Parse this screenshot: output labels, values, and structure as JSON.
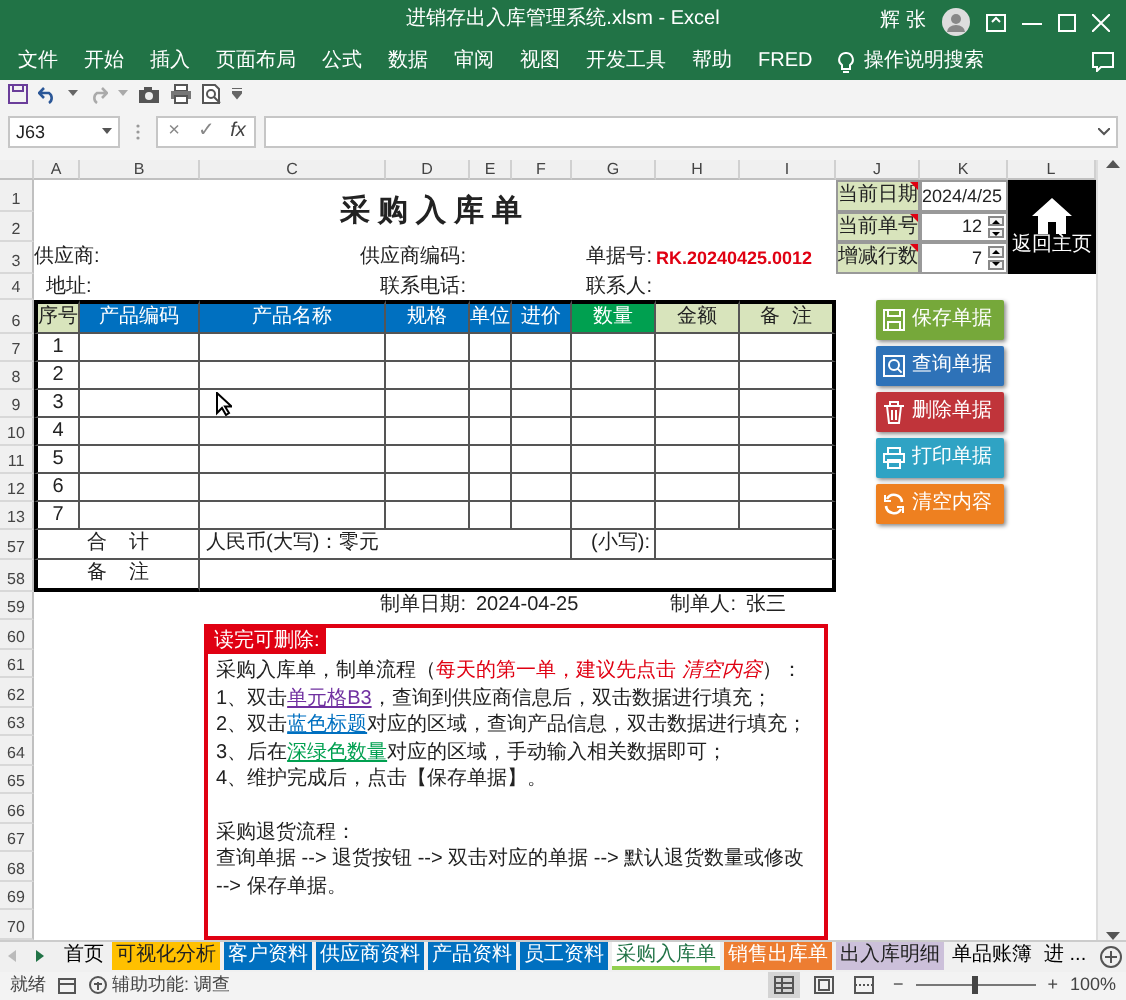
{
  "window": {
    "title": "进销存出入库管理系统.xlsm  -  Excel",
    "user": "辉 张"
  },
  "ribbon_tabs": [
    "文件",
    "开始",
    "插入",
    "页面布局",
    "公式",
    "数据",
    "审阅",
    "视图",
    "开发工具",
    "帮助",
    "FRED"
  ],
  "tell_me": "操作说明搜索",
  "formula_bar": {
    "name_box": "J63",
    "cancel": "×",
    "enter": "✓",
    "function": "fx"
  },
  "columns": [
    "A",
    "B",
    "C",
    "D",
    "E",
    "F",
    "G",
    "H",
    "I",
    "J",
    "K",
    "L"
  ],
  "rows": [
    "1",
    "2",
    "3",
    "4",
    "6",
    "7",
    "8",
    "9",
    "10",
    "11",
    "12",
    "13",
    "57",
    "58",
    "59",
    "60",
    "61",
    "62",
    "63",
    "64",
    "65",
    "66",
    "67",
    "68",
    "69",
    "70"
  ],
  "form": {
    "title": "采购入库单",
    "info": [
      {
        "label": "当前日期",
        "value": "2024/4/25",
        "kind": "date"
      },
      {
        "label": "当前单号",
        "value": "12",
        "kind": "spinner"
      },
      {
        "label": "增减行数",
        "value": "7",
        "kind": "spinner"
      }
    ],
    "home_button": "返回主页",
    "supplier_label": "供应商:",
    "supplier_code_label": "供应商编码:",
    "doc_no_label": "单据号:",
    "doc_no": "RK.20240425.0012",
    "address_label": "地址:",
    "phone_label": "联系电话:",
    "contact_label": "联系人:",
    "columns": [
      {
        "label": "序号",
        "color": "#d8e4bc"
      },
      {
        "label": "产品编码",
        "color": "#0070c0"
      },
      {
        "label": "产品名称",
        "color": "#0070c0"
      },
      {
        "label": "规格",
        "color": "#0070c0"
      },
      {
        "label": "单位",
        "color": "#0070c0"
      },
      {
        "label": "进价",
        "color": "#0070c0"
      },
      {
        "label": "数量",
        "color": "#00a050"
      },
      {
        "label": "金额",
        "color": "#d8e4bc"
      },
      {
        "label": "备  注",
        "color": "#d8e4bc"
      }
    ],
    "line_numbers": [
      "1",
      "2",
      "3",
      "4",
      "5",
      "6",
      "7"
    ],
    "total_label": "合    计",
    "amount_words": "人民币(大写)：零元",
    "amount_figures_label": "(小写):",
    "remark_label": "备    注",
    "prepared_date_label": "制单日期:",
    "prepared_date": "2024-04-25",
    "preparer_label": "制单人:",
    "preparer": "张三"
  },
  "actions": [
    {
      "label": "保存单据",
      "kind": "save",
      "color": "#76a83a"
    },
    {
      "label": "查询单据",
      "kind": "search",
      "color": "#2e72b8"
    },
    {
      "label": "删除单据",
      "kind": "delete",
      "color": "#c0343a"
    },
    {
      "label": "打印单据",
      "kind": "print",
      "color": "#2fa3c4"
    },
    {
      "label": "清空内容",
      "kind": "clear",
      "color": "#ee8020"
    }
  ],
  "notice": {
    "badge": "读完可删除:",
    "lines": [
      {
        "gap_before": false,
        "segments": [
          {
            "text": "采购入库单，制单流程（",
            "kind": "plain"
          },
          {
            "text": "每天的第一单，建议先点击 *清空内容*",
            "kind": "red"
          },
          {
            "text": "）：",
            "kind": "plain"
          }
        ]
      },
      {
        "gap_before": false,
        "segments": [
          {
            "text": "1、双击",
            "kind": "plain"
          },
          {
            "text": "单元格B3",
            "kind": "link_purple"
          },
          {
            "text": "，查询到供应商信息后，双击数据进行填充；",
            "kind": "plain"
          }
        ]
      },
      {
        "gap_before": false,
        "segments": [
          {
            "text": "2、双击",
            "kind": "plain"
          },
          {
            "text": "蓝色标题",
            "kind": "link_blue"
          },
          {
            "text": "对应的区域，查询产品信息，双击数据进行填充；",
            "kind": "plain"
          }
        ]
      },
      {
        "gap_before": false,
        "segments": [
          {
            "text": "3、后在",
            "kind": "plain"
          },
          {
            "text": "深绿色数量",
            "kind": "link_green"
          },
          {
            "text": "对应的区域，手动输入相关数据即可；",
            "kind": "plain"
          }
        ]
      },
      {
        "gap_before": false,
        "segments": [
          {
            "text": "4、维护完成后，点击【保存单据】。",
            "kind": "plain"
          }
        ]
      },
      {
        "gap_before": true,
        "segments": [
          {
            "text": "采购退货流程：",
            "kind": "plain"
          }
        ]
      },
      {
        "gap_before": false,
        "segments": [
          {
            "text": "查询单据 --> 退货按钮 --> 双击对应的单据 --> 默认退货数量或修改 --> 保存单据。",
            "kind": "plain"
          }
        ]
      }
    ]
  },
  "sheet_tabs": [
    {
      "label": "首页",
      "selected": false
    },
    {
      "label": "可视化分析",
      "selected": false,
      "color": "#ffc000"
    },
    {
      "label": "客户资料",
      "selected": false,
      "color": "#0070c0"
    },
    {
      "label": "供应商资料",
      "selected": false,
      "color": "#0070c0"
    },
    {
      "label": "产品资料",
      "selected": false,
      "color": "#0070c0"
    },
    {
      "label": "员工资料",
      "selected": false,
      "color": "#0070c0"
    },
    {
      "label": "采购入库单",
      "selected": true,
      "color": "#92d050"
    },
    {
      "label": "销售出库单",
      "selected": false,
      "color": "#ed7d31"
    },
    {
      "label": "出入库明细",
      "selected": false,
      "color": "#ccc0da"
    },
    {
      "label": "单品账簿",
      "selected": false
    },
    {
      "label": "进 ...",
      "selected": false
    }
  ],
  "status_bar": {
    "ready": "就绪",
    "accessibility": "辅助功能: 调查",
    "views": [
      {
        "kind": "normal",
        "selected": true
      },
      {
        "kind": "page_layout",
        "selected": false
      },
      {
        "kind": "page_break",
        "selected": false
      }
    ],
    "zoom_out": "−",
    "zoom_in": "+",
    "zoom_slider": {
      "level": 0.5
    },
    "zoom": "100%"
  }
}
